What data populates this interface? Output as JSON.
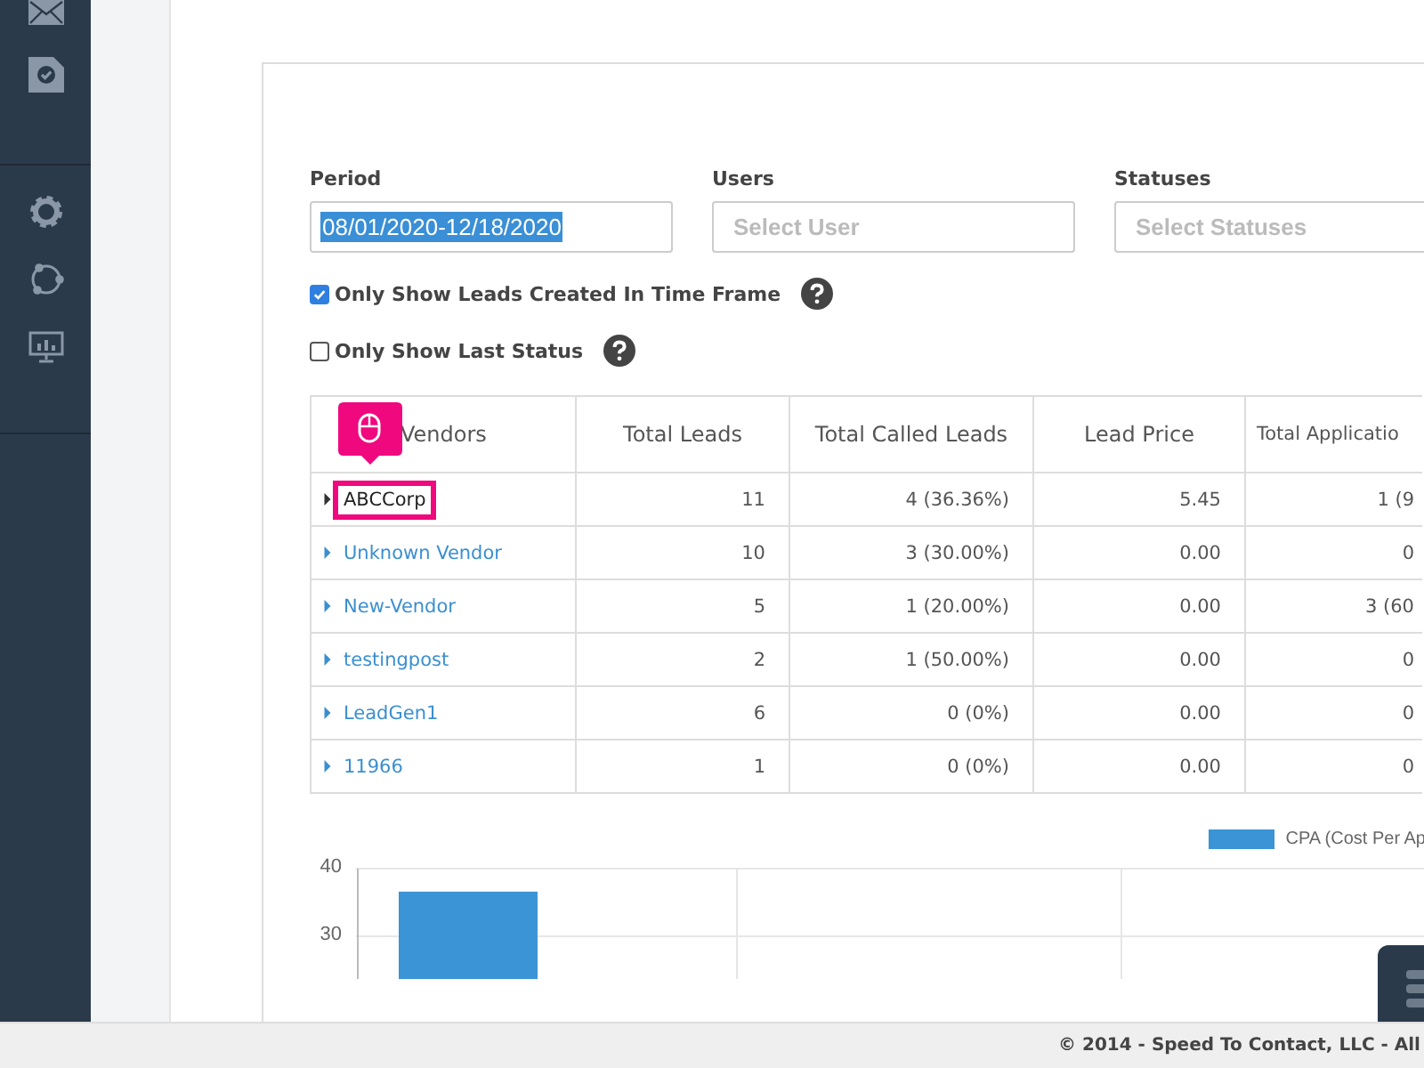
{
  "sidebar": {
    "items": [
      {
        "kind": "mail"
      },
      {
        "kind": "task"
      },
      {
        "kind": "settings"
      },
      {
        "kind": "network"
      },
      {
        "kind": "monitor"
      }
    ]
  },
  "filters": [
    {
      "label": "Period",
      "value": "08/01/2020-12/18/2020",
      "selected": true
    },
    {
      "label": "Users",
      "placeholder": "Select User"
    },
    {
      "label": "Statuses",
      "placeholder": "Select Statuses"
    }
  ],
  "options": [
    {
      "label": "Only Show Leads Created In Time Frame",
      "checked": true
    },
    {
      "label": "Only Show Last Status",
      "checked": false
    }
  ],
  "table": {
    "columns": [
      "Vendors",
      "Total Leads",
      "Total Called Leads",
      "Lead Price",
      "Total Applicatio"
    ],
    "rows": [
      {
        "highlighted": true,
        "cells": [
          "ABCCorp",
          "11",
          "4 (36.36%)",
          "5.45",
          "1 (9"
        ]
      },
      {
        "highlighted": false,
        "cells": [
          "Unknown Vendor",
          "10",
          "3 (30.00%)",
          "0.00",
          "0"
        ]
      },
      {
        "highlighted": false,
        "cells": [
          "New-Vendor",
          "5",
          "1 (20.00%)",
          "0.00",
          "3 (60"
        ]
      },
      {
        "highlighted": false,
        "cells": [
          "testingpost",
          "2",
          "1 (50.00%)",
          "0.00",
          "0"
        ]
      },
      {
        "highlighted": false,
        "cells": [
          "LeadGen1",
          "6",
          "0 (0%)",
          "0.00",
          "0"
        ]
      },
      {
        "highlighted": false,
        "cells": [
          "11966",
          "1",
          "0 (0%)",
          "0.00",
          "0"
        ]
      }
    ]
  },
  "chart_data": {
    "type": "bar",
    "ylim": [
      0,
      40
    ],
    "yticks": [
      30,
      40
    ],
    "series": [
      {
        "name": "CPA (Cost Per Ap",
        "color": "#3a94d6",
        "values": [
          36.6
        ]
      }
    ]
  },
  "footer": "© 2014 - Speed To Contact, LLC - All"
}
